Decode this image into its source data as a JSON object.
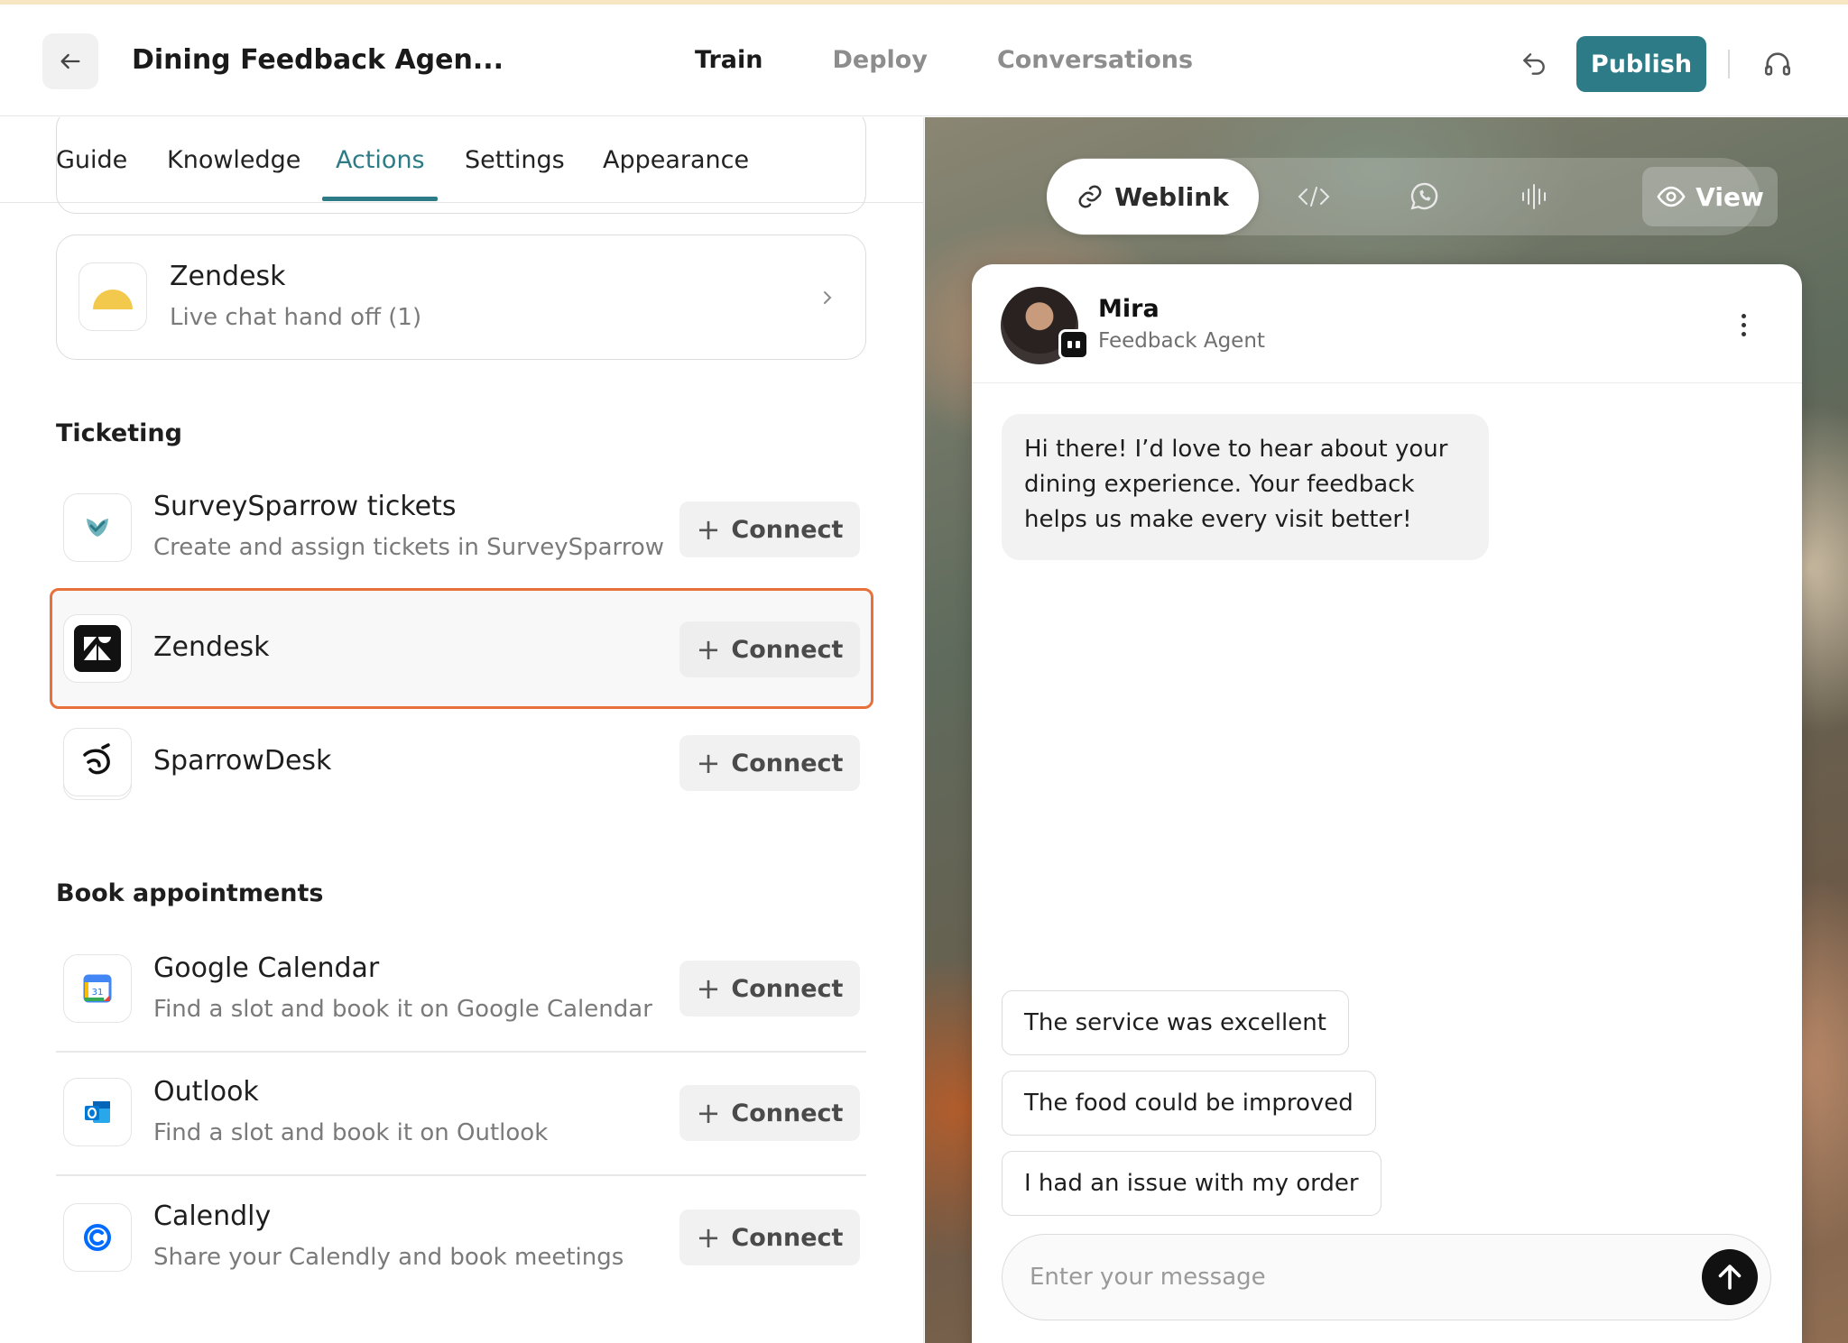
{
  "header": {
    "title": "Dining Feedback Agen...",
    "tabs": [
      "Train",
      "Deploy",
      "Conversations"
    ],
    "publish_label": "Publish"
  },
  "subtabs": [
    "Guide",
    "Knowledge",
    "Actions",
    "Settings",
    "Appearance"
  ],
  "handoff_card": {
    "title": "Zendesk",
    "subtitle": "Live chat hand off (1)"
  },
  "ticketing": {
    "title": "Ticketing",
    "items": [
      {
        "name": "SurveySparrow tickets",
        "desc": "Create and assign tickets in SurveySparrow"
      },
      {
        "name": "Zendesk",
        "desc": ""
      },
      {
        "name": "SparrowDesk",
        "desc": ""
      }
    ]
  },
  "appointments": {
    "title": "Book appointments",
    "items": [
      {
        "name": "Google Calendar",
        "desc": "Find a slot and book it on Google Calendar"
      },
      {
        "name": "Outlook",
        "desc": "Find a slot and book it on Outlook"
      },
      {
        "name": "Calendly",
        "desc": "Share your Calendly and book meetings"
      }
    ]
  },
  "connect_label": "Connect",
  "preview": {
    "weblink_label": "Weblink",
    "view_label": "View",
    "agent_name": "Mira",
    "agent_role": "Feedback Agent",
    "greeting": "Hi there! I’d love to hear about your dining experience. Your feedback helps us make every visit better!",
    "suggestions": [
      "The service was excellent",
      "The food could be improved",
      "I had an issue with my order"
    ],
    "input_placeholder": "Enter your message"
  },
  "colors": {
    "accent": "#2d7b86",
    "highlight": "#e8703a"
  }
}
